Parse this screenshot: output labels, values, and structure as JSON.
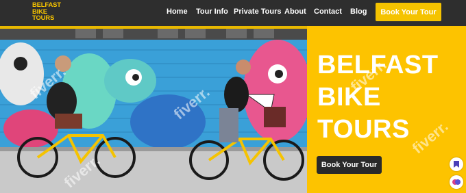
{
  "logo": {
    "line1": "BELFAST",
    "line2": "BIKE",
    "line3": "TOURS"
  },
  "nav": {
    "items": [
      "Home",
      "Tour Info",
      "Private Tours",
      "About",
      "Contact",
      "Blog"
    ],
    "cta": "Book Your Tour"
  },
  "hero": {
    "title_lines": [
      "BELFAST",
      "BIKE",
      "TOURS"
    ],
    "cta": "Book Your Tour"
  },
  "colors": {
    "brand_yellow": "#fdc300",
    "nav_bg": "#2e2e2e",
    "button_dark": "#2a2a2a"
  },
  "watermark": "fiverr.",
  "side_icons": [
    "bookmark-icon",
    "brain-icon"
  ]
}
